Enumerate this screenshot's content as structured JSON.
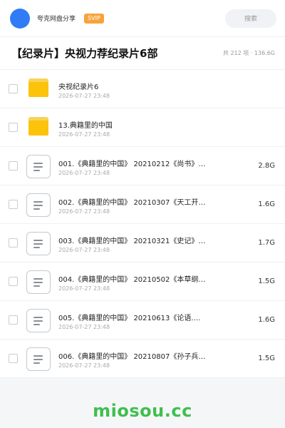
{
  "header": {
    "user_name": "夸克网盘分享",
    "badge": "SVIP",
    "search_placeholder": "搜索",
    "avatar_color": "#2f7cf6"
  },
  "title_bar": {
    "title": "【纪录片】央视力荐纪录片6部",
    "summary": "共 212 项 · 136.6G"
  },
  "rows": [
    {
      "type": "folder",
      "name": "央视纪录片6",
      "date": "2026-07-27 23:48",
      "size": ""
    },
    {
      "type": "folder",
      "name": "13.典籍里的中国",
      "date": "2026-07-27 23:48",
      "size": ""
    },
    {
      "type": "file",
      "name": "001.《典籍里的中国》 20210212《尚书》…",
      "date": "2026-07-27 23:48",
      "size": "2.8G"
    },
    {
      "type": "file",
      "name": "002.《典籍里的中国》 20210307《天工开…",
      "date": "2026-07-27 23:48",
      "size": "1.6G"
    },
    {
      "type": "file",
      "name": "003.《典籍里的中国》 20210321《史记》…",
      "date": "2026-07-27 23:48",
      "size": "1.7G"
    },
    {
      "type": "file",
      "name": "004.《典籍里的中国》 20210502《本草纲…",
      "date": "2026-07-27 23:48",
      "size": "1.5G"
    },
    {
      "type": "file",
      "name": "005.《典籍里的中国》 20210613《论语.…",
      "date": "2026-07-27 23:48",
      "size": "1.6G"
    },
    {
      "type": "file",
      "name": "006.《典籍里的中国》 20210807《孙子兵…",
      "date": "2026-07-27 23:48",
      "size": "1.5G"
    }
  ],
  "watermark": "miosou.cc",
  "colors": {
    "accent": "#2f7cf6",
    "svip": "#f7a33b",
    "folder": "#fbc30a",
    "watermark": "#3fbf4f"
  }
}
